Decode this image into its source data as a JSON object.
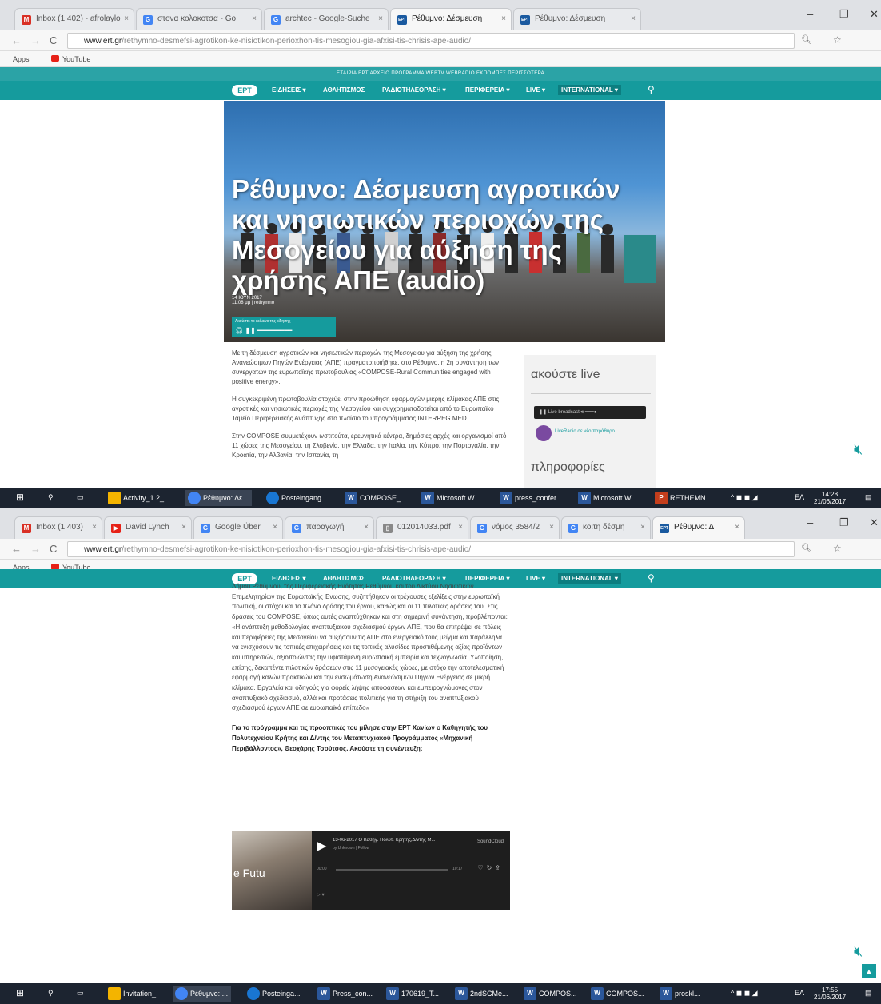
{
  "shot1": {
    "tabs": [
      {
        "label": "Inbox (1.402) - afrolaylo",
        "fav": "M",
        "color": "#d93025"
      },
      {
        "label": "στονα κολοκοτσα - Go",
        "fav": "G",
        "color": "#4285f4"
      },
      {
        "label": "archtec - Google-Suche",
        "fav": "G",
        "color": "#4285f4"
      },
      {
        "label": "Ρέθυμνο: Δέσμευση",
        "fav": "ΕΡΤ",
        "color": "#1a5aa0"
      },
      {
        "label": "Ρέθυμνο: Δέσμευση",
        "fav": "ΕΡΤ",
        "color": "#1a5aa0"
      }
    ],
    "url_host": "www.ert.gr",
    "url_path": "/rethymno-desmefsi-agrotikon-ke-nisiotikon-perioxhon-tis-mesogiou-gia-afxisi-tis-chrisis-ape-audio/",
    "bookmarks": [
      "Apps",
      "YouTube"
    ],
    "taskbar": [
      "Activity_1.2_",
      "Ρέθυμνο: Δε...",
      "Posteingang...",
      "COMPOSE_...",
      "Microsoft W...",
      "press_confer...",
      "Microsoft W...",
      "RETHEMN..."
    ],
    "clock": {
      "time": "14:28",
      "date": "21/06/2017"
    },
    "lang": "ΕΛ"
  },
  "shot2": {
    "tabs": [
      {
        "label": "Inbox (1.403)",
        "fav": "M",
        "color": "#d93025"
      },
      {
        "label": "David Lynch",
        "fav": "▶",
        "color": "#e62117"
      },
      {
        "label": "Google Über",
        "fav": "G",
        "color": "#4285f4"
      },
      {
        "label": "παραγωγή",
        "fav": "G",
        "color": "#4285f4"
      },
      {
        "label": "012014033.pdf",
        "fav": "▯",
        "color": "#888888"
      },
      {
        "label": "νόμος 3584/2",
        "fav": "G",
        "color": "#4285f4"
      },
      {
        "label": "κοιτη δέσμη",
        "fav": "G",
        "color": "#4285f4"
      },
      {
        "label": "Ρέθυμνο: Δ",
        "fav": "ΕΡΤ",
        "color": "#1a5aa0"
      }
    ],
    "url_host": "www.ert.gr",
    "url_path": "/rethymno-desmefsi-agrotikon-ke-nisiotikon-perioxhon-tis-mesogiou-gia-afxisi-tis-chrisis-ape-audio/",
    "bookmarks": [
      "Apps",
      "YouTube"
    ],
    "taskbar": [
      "Invitation_",
      "Ρέθυμνο: ...",
      "Posteinga...",
      "Press_con...",
      "170619_T...",
      "2ndSCMe...",
      "COMPOS...",
      "COMPOS...",
      "proskl..."
    ],
    "clock": {
      "time": "17:55",
      "date": "21/06/2017"
    },
    "lang": "ΕΛ"
  },
  "site": {
    "logo": "ΕΡΤ",
    "subnav": "ΕΤΑΙΡΙΑ   ΕΡΤ ΑΡΧΕΙΟ   ΠΡΟΓΡΑΜΜΑ   WEBTV   WEBRADIO   ΕΚΠΟΜΠΕΣ   ΠΕΡΙΣΣΟΤΕΡΑ",
    "nav": [
      "ΕΙΔΗΣΕΙΣ ▾",
      "ΑΘΛΗΤΙΣΜΟΣ",
      "ΡΑΔΙΟΤΗΛΕΟΡΑΣΗ ▾",
      "ΠΕΡΙΦΕΡΕΙΑ ▾",
      "LIVE ▾",
      "INTERNATIONAL ▾"
    ],
    "accent": "#159b9d"
  },
  "article": {
    "title": "Ρέθυμνο: Δέσμευση αγροτικών και νησιωτικών περιοχών της Μεσογείου για αύξηση της χρήσης ΑΠΕ (audio)",
    "date": "14 ΙΟΥΝ 2017",
    "time": "11:08 μμ | rethymno",
    "player_label": "Ακούστε το κείμενο της είδησης",
    "p1": "Με τη δέσμευση αγροτικών και νησιωτικών περιοχών της Μεσογείου για αύξηση της χρήσης Ανανεώσιμων Πηγών Ενέργειας (ΑΠΕ) πραγματοποιήθηκε, στο Ρέθυμνο, η 2η συνάντηση των συνεργατών της ευρωπαϊκής πρωτοβουλίας «COMPOSE-Rural Communities engaged with positive energy».",
    "p2": "Η συγκεκριμένη πρωτοβουλία στοχεύει στην προώθηση εφαρμογών μικρής κλίμακας ΑΠΕ στις αγροτικές και νησιωτικές περιοχές της Μεσογείου και συγχρηματοδοτείται από το Ευρωπαϊκό Ταμείο Περιφερειακής Ανάπτυξης στο πλαίσιο του προγράμματος INTERREG MED.",
    "p3": "Στην COMPOSE συμμετέχουν ινστιτούτα, ερευνητικά κέντρα, δημόσιες αρχές και οργανισμοί από 11 χώρες της Μεσογείου, τη Σλοβενία, την Ελλάδα, την Ιταλία, την Κύπρο, την Πορτογαλία, την Κροατία, την Αλβανία, την Ισπανία, τη",
    "p4": "Δήμου Ρεθύμνου, της Περιφερειακής Ενότητας Ρεθύμνου και του Δικτύου Νησιωτικών Επιμελητηρίων της Ευρωπαϊκής Ένωσης, συζητήθηκαν οι τρέχουσες εξελίξεις στην ευρωπαϊκή πολιτική, οι στόχοι και το πλάνο δράσης του έργου, καθώς και οι 11 πιλοτικές δράσεις του. Στις δράσεις του COMPOSE, όπως αυτές αναπτύχθηκαν και στη σημερινή συνάντηση, προβλέπονται: «Η ανάπτυξη μεθοδολογίας αναπτυξιακού σχεδιασμού έργων ΑΠΕ, που θα επιτρέψει σε πόλεις και περιφέρειες της Μεσογείου να αυξήσουν τις ΑΠΕ στο ενεργειακό τους μείγμα και παράλληλα να ενισχύσουν τις τοπικές επιχειρήσεις και τις τοπικές αλυσίδες προστιθέμενης αξίας προϊόντων και υπηρεσιών, αξιοποιώντας την υφιστάμενη ευρωπαϊκή εμπειρία και τεχνογνωσία. Υλοποίηση, επίσης, δεκαπέντε πιλοτικών δράσεων στις 11 μεσογειακές χώρες, με στόχο την αποτελεσματική εφαρμογή καλών πρακτικών και την ενσωμάτωση Ανανεώσιμων Πηγών Ενέργειας σε μικρή κλίμακα. Εργαλεία και οδηγούς για φορείς λήψης αποφάσεων και εμπειρογνώμονες στον αναπτυξιακό σχεδιασμό, αλλά και προτάσεις πολιτικής για τη στήριξη του αναπτυξιακού σχεδιασμού έργων ΑΠΕ σε ευρωπαϊκό επίπεδο»",
    "p5": "Για το πρόγραμμα και τις προοπτικές του μίλησε στην ΕΡΤ Χανίων ο Καθηγητής του Πολυτεχνείου Κρήτης και Δ/ντής του Μεταπτυχιακού Προγράμματος «Μηχανική Περιβάλλοντος», Θεοχάρης Τσούτσος. Ακούστε τη συνέντευξη:"
  },
  "sidebar": {
    "listen_live": "ακούστε live",
    "radio_label": "LiveRadio σε νέο παράθυρο",
    "radio_status": "Live broadcast",
    "info": "πληροφορίες"
  },
  "embed": {
    "title": "13-06-2017 Ο Καθηγ. Πολυτ. Κρήτης,Δ/ντής Μ...",
    "user": "by Unknown | Follow",
    "service": "SoundCloud",
    "elapsed": "00:00",
    "duration": "10:17",
    "photo_text": "e Futu"
  }
}
